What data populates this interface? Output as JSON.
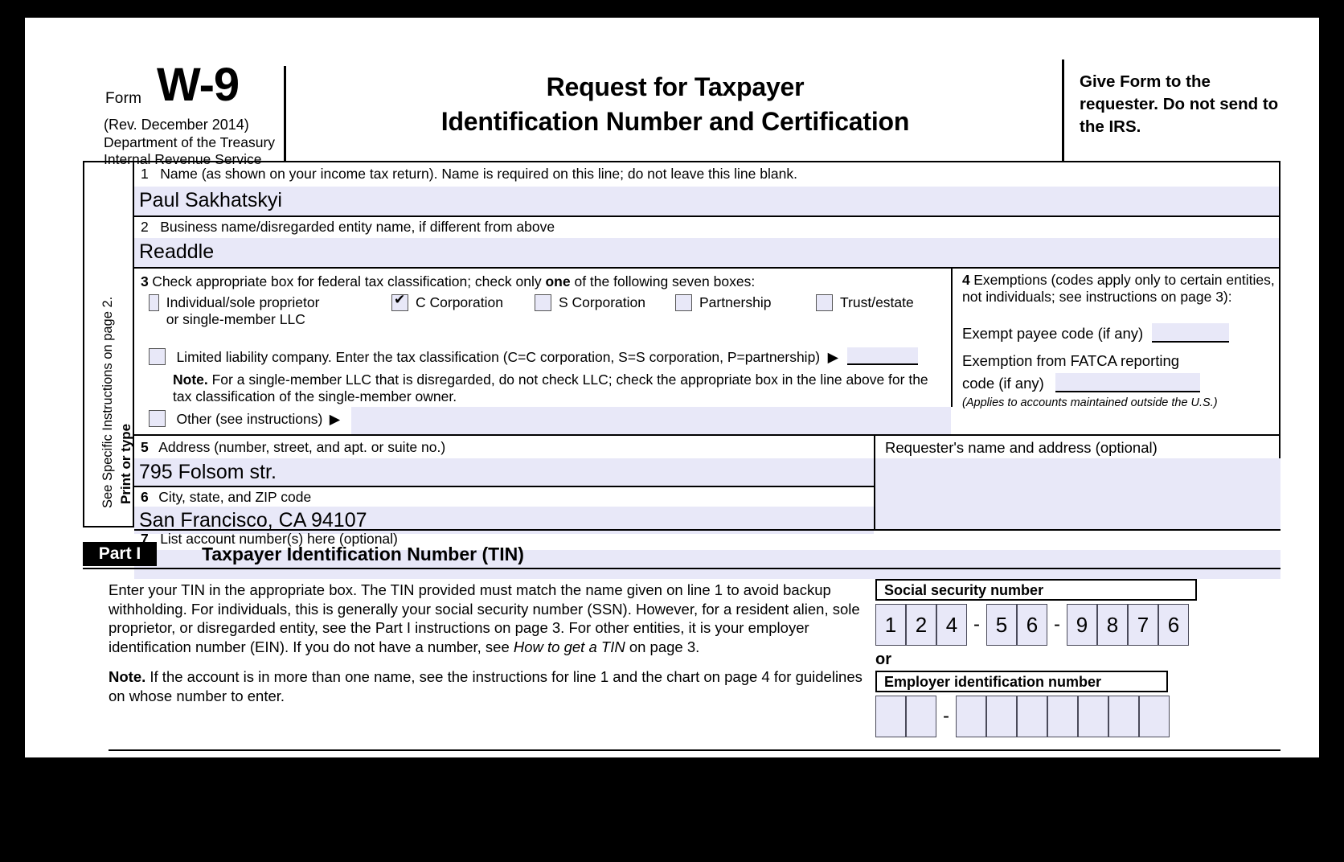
{
  "header": {
    "form_word": "Form",
    "form_number": "W-9",
    "revision": "(Rev. December 2014)",
    "dept_line1": "Department of the Treasury",
    "dept_line2": "Internal Revenue Service",
    "title_line1": "Request for Taxpayer",
    "title_line2": "Identification Number and Certification",
    "give_form_note": "Give Form to the requester. Do not send to the IRS."
  },
  "sidebar": {
    "line1": "Print or type",
    "line2": "See Specific Instructions on page 2."
  },
  "line1": {
    "number": "1",
    "label": "Name (as shown on your income tax return). Name is required on this line; do not leave this line blank.",
    "value": "Paul Sakhatskyi"
  },
  "line2": {
    "number": "2",
    "label": "Business name/disregarded entity name, if different from above",
    "value": "Readdle"
  },
  "line3": {
    "number": "3",
    "label_pre": "Check appropriate box for federal tax classification; check only ",
    "label_bold": "one",
    "label_post": " of the following seven boxes:",
    "checkboxes": [
      {
        "name": "individual-sole-proprietor",
        "label": "Individual/sole proprietor or single-member LLC",
        "checked": false
      },
      {
        "name": "c-corporation",
        "label": "C Corporation",
        "checked": true
      },
      {
        "name": "s-corporation",
        "label": "S Corporation",
        "checked": false
      },
      {
        "name": "partnership",
        "label": "Partnership",
        "checked": false
      },
      {
        "name": "trust-estate",
        "label": "Trust/estate",
        "checked": false
      }
    ],
    "llc_label": "Limited liability company. Enter the tax classification (C=C corporation, S=S corporation, P=partnership)",
    "llc_arrow": "▶",
    "llc_value": "",
    "note_bold": "Note.",
    "note_text": " For a single-member LLC that is disregarded, do not check LLC; check the appropriate box in the line above for the tax classification of the single-member owner.",
    "other_label": "Other (see instructions)",
    "other_arrow": "▶",
    "other_value": ""
  },
  "line4": {
    "number": "4",
    "label": "Exemptions (codes apply only to certain entities, not individuals; see instructions on page 3):",
    "exempt_payee_label": "Exempt payee code (if any)",
    "exempt_payee_value": "",
    "fatca_label_line1": "Exemption from FATCA reporting",
    "fatca_label_line2": "code (if any)",
    "fatca_value": "",
    "applies_note": "(Applies to accounts maintained outside the U.S.)"
  },
  "line5": {
    "number": "5",
    "label": "Address (number, street, and apt. or suite no.)",
    "value": "795 Folsom str."
  },
  "line6": {
    "number": "6",
    "label": "City, state, and ZIP code",
    "value": "San Francisco, CA 94107"
  },
  "line7": {
    "number": "7",
    "label": "List account number(s) here (optional)",
    "value": ""
  },
  "requester": {
    "label": "Requester's name and address (optional)",
    "value": ""
  },
  "part1": {
    "tag": "Part I",
    "title": "Taxpayer Identification Number (TIN)",
    "paragraph1_a": "Enter your TIN in the appropriate box. The TIN provided must match the name given on line 1 to avoid backup withholding. For individuals, this is generally your social security number (SSN). However, for a resident alien, sole proprietor, or disregarded entity, see the Part I instructions on page 3. For other entities, it is your employer identification number (EIN). If you do not have a number, see ",
    "paragraph1_italic": "How to get a TIN",
    "paragraph1_b": " on page 3.",
    "note_bold": "Note.",
    "note_text": " If the account is in more than one name, see the instructions for line 1 and the chart on page 4 for guidelines on whose number to enter.",
    "ssn_caption": "Social security number",
    "ssn_digits": [
      "1",
      "2",
      "4",
      "-",
      "5",
      "6",
      "-",
      "9",
      "8",
      "7",
      "6"
    ],
    "or_label": "or",
    "ein_caption": "Employer identification number",
    "ein_digits": [
      "",
      "",
      "-",
      "",
      "",
      "",
      "",
      "",
      "",
      ""
    ]
  },
  "colors": {
    "field_fill": "#e8e8f8",
    "rule": "#000000",
    "page_bg": "#ffffff",
    "outer_bg": "#000000"
  }
}
